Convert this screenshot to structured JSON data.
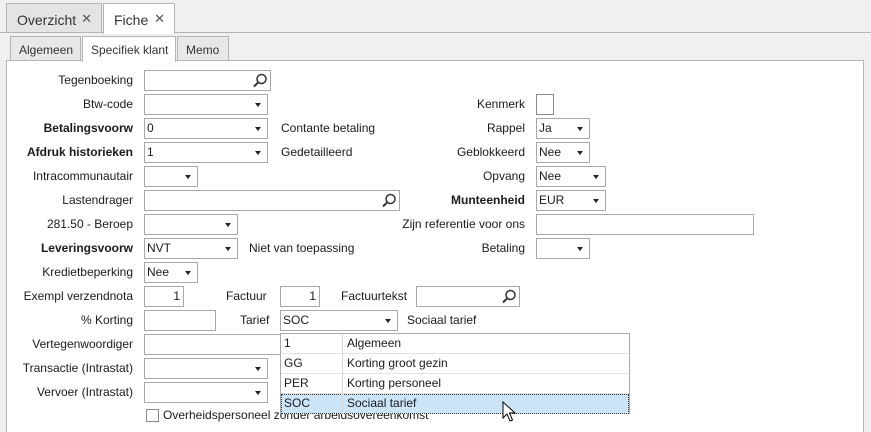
{
  "doc_tabs": [
    {
      "label": "Overzicht",
      "close": "✕"
    },
    {
      "label": "Fiche",
      "close": "✕"
    }
  ],
  "sub_tabs": [
    "Algemeen",
    "Specifiek klant",
    "Memo"
  ],
  "left_form": {
    "tegenboeking": {
      "label": "Tegenboeking",
      "value": ""
    },
    "btw_code": {
      "label": "Btw-code",
      "value": ""
    },
    "betalingsvoorw": {
      "label": "Betalingsvoorw",
      "value": "0",
      "desc": "Contante betaling"
    },
    "afdruk_historieken": {
      "label": "Afdruk historieken",
      "value": "1",
      "desc": "Gedetailleerd"
    },
    "intracommunautair": {
      "label": "Intracommunautair",
      "value": ""
    },
    "lastendrager": {
      "label": "Lastendrager",
      "value": ""
    },
    "beroep": {
      "label": "281.50 - Beroep",
      "value": ""
    },
    "leveringsvoorw": {
      "label": "Leveringsvoorw",
      "value": "NVT",
      "desc": "Niet van toepassing"
    },
    "kredietbeperking": {
      "label": "Kredietbeperking",
      "value": "Nee"
    },
    "exempl_verzendnota": {
      "label": "Exempl verzendnota",
      "value": "1"
    },
    "factuur": {
      "label": "Factuur",
      "value": "1"
    },
    "factuurtekst": {
      "label": "Factuurtekst",
      "value": ""
    },
    "korting": {
      "label": "% Korting",
      "value": ""
    },
    "tarief": {
      "label": "Tarief",
      "value": "SOC",
      "desc": "Sociaal tarief"
    },
    "vertegenwoordiger": {
      "label": "Vertegenwoordiger",
      "value": ""
    },
    "transactie": {
      "label": "Transactie (Intrastat)",
      "value": ""
    },
    "vervoer": {
      "label": "Vervoer (Intrastat)",
      "value": ""
    },
    "overheidspersoneel": {
      "label": "Overheidspersoneel zonder arbeidsovereenkomst",
      "checked": false
    }
  },
  "right_form": {
    "kenmerk": {
      "label": "Kenmerk",
      "checked": false
    },
    "rappel": {
      "label": "Rappel",
      "value": "Ja"
    },
    "geblokkeerd": {
      "label": "Geblokkeerd",
      "value": "Nee"
    },
    "opvang": {
      "label": "Opvang",
      "value": "Nee"
    },
    "munteenheid": {
      "label": "Munteenheid",
      "value": "EUR"
    },
    "zijn_referentie": {
      "label": "Zijn referentie voor ons",
      "value": ""
    },
    "betaling": {
      "label": "Betaling",
      "value": ""
    }
  },
  "tarief_dropdown": [
    {
      "code": "1",
      "name": "Algemeen"
    },
    {
      "code": "GG",
      "name": "Korting groot gezin"
    },
    {
      "code": "PER",
      "name": "Korting personeel"
    },
    {
      "code": "SOC",
      "name": "Sociaal tarief",
      "selected": true
    }
  ],
  "colors": {
    "selection": "#cce4f7",
    "border": "#a9a9a9",
    "background": "#f0f0f0"
  }
}
